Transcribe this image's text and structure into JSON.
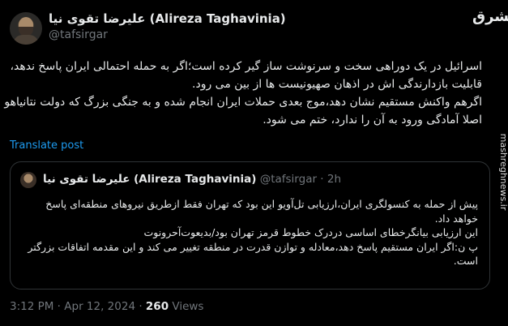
{
  "author": {
    "display_name": "علیرضا تقوی نیا (Alireza Taghavinia)",
    "handle": "@tafsirgar"
  },
  "tweet": {
    "lines": [
      "اسرائیل در یک دوراهی سخت و سرنوشت ساز گیر کرده است؛اگر به حمله احتمالی ایران پاسخ ندهد،",
      "قابلیت بازدارندگی اش در اذهان صهیونیست ها از بین می رود.",
      "اگرهم واکنش مستقیم نشان دهد،موج بعدی حملات ایران انجام شده و به جنگی بزرگ که دولت نتانیاهو",
      "اصلا آمادگی ورود به آن را ندارد، ختم می شود."
    ],
    "translate_label": "Translate post"
  },
  "quote": {
    "display_name": "علیرضا تقوی نیا (Alireza Taghavinia)",
    "handle_time": "@tafsirgar · 2h",
    "lines": [
      "پیش از حمله به کنسولگری ایران،ارزیابی تل‌آویو این بود که تهران فقط ازطریق نیروهای منطقه‌ای پاسخ",
      "خواهد داد.",
      "این ارزیابی بیانگرخطای اساسی دردرک خطوط قرمز تهران بود/بدیعوت‌آحرونوت",
      "پ ن:اگر ایران مستقیم پاسخ دهد،معادله و توازن قدرت در منطقه تغییر می کند و این مقدمه اتفاقات بزرگتر",
      "است."
    ]
  },
  "footer": {
    "timestamp": "3:12 PM · Apr 12, 2024 · ",
    "views_count": "260",
    "views_label": " Views"
  },
  "watermark": {
    "logo": "مشرق",
    "site": "mashreghnews.ir"
  }
}
